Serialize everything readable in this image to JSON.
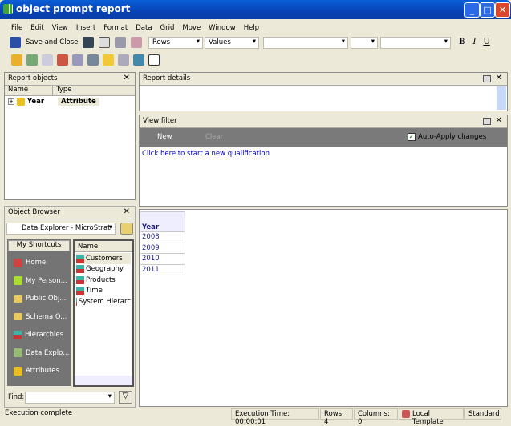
{
  "window": {
    "title": "object prompt report"
  },
  "menu": [
    "File",
    "Edit",
    "View",
    "Insert",
    "Format",
    "Data",
    "Grid",
    "Move",
    "Window",
    "Help"
  ],
  "toolbar": {
    "save_label": "Save and Close",
    "rows": "Rows",
    "values": "Values"
  },
  "report_objects": {
    "title": "Report objects",
    "col_name": "Name",
    "col_type": "Type",
    "items": [
      {
        "name": "Year",
        "type": "Attribute"
      }
    ]
  },
  "report_details": {
    "title": "Report details"
  },
  "view_filter": {
    "title": "View filter",
    "new": "New",
    "clear": "Clear",
    "auto_apply": "Auto-Apply changes",
    "hint": "Click here to start a new qualification"
  },
  "object_browser": {
    "title": "Object Browser",
    "source": "Data Explorer - MicroStrat",
    "shortcuts_title": "My Shortcuts",
    "shortcuts": [
      "Home",
      "My Person...",
      "Public Obj...",
      "Schema O...",
      "Hierarchies",
      "Data Explo...",
      "Attributes"
    ],
    "list_header": "Name",
    "items": [
      "Customers",
      "Geography",
      "Products",
      "Time",
      "System Hierarc"
    ],
    "find_label": "Find:"
  },
  "grid": {
    "header": "Year",
    "rows": [
      "2008",
      "2009",
      "2010",
      "2011"
    ]
  },
  "status": {
    "message": "Execution complete",
    "exec_time": "Execution Time: 00:00:01",
    "rows": "Rows: 4",
    "columns": "Columns: 0",
    "template": "Local Template",
    "mode": "Standard"
  }
}
